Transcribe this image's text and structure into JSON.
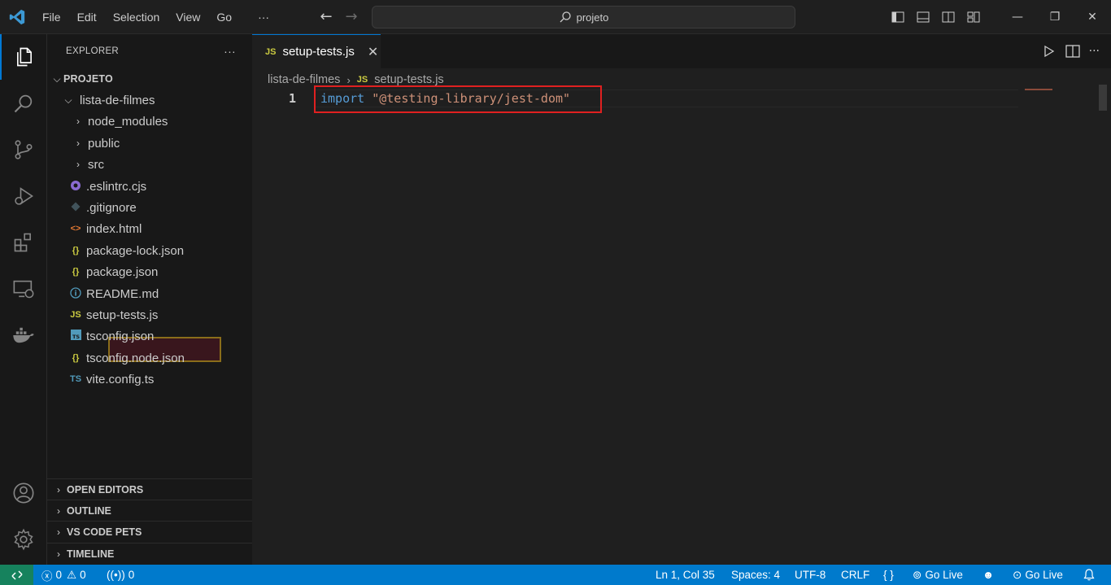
{
  "menu": [
    "File",
    "Edit",
    "Selection",
    "View",
    "Go",
    "···"
  ],
  "search": {
    "text": "projeto"
  },
  "window_controls": {
    "minimize": "—",
    "restore": "❐",
    "close": "✕"
  },
  "sidebar": {
    "title": "EXPLORER",
    "more": "···",
    "root": "PROJETO",
    "folder": "lista-de-filmes",
    "items": [
      {
        "label": "node_modules",
        "kind": "folder"
      },
      {
        "label": "public",
        "kind": "folder"
      },
      {
        "label": "src",
        "kind": "folder"
      },
      {
        "label": ".eslintrc.cjs",
        "kind": "eslint"
      },
      {
        "label": ".gitignore",
        "kind": "git"
      },
      {
        "label": "index.html",
        "kind": "html"
      },
      {
        "label": "package-lock.json",
        "kind": "json"
      },
      {
        "label": "package.json",
        "kind": "json"
      },
      {
        "label": "README.md",
        "kind": "info"
      },
      {
        "label": "setup-tests.js",
        "kind": "js"
      },
      {
        "label": "tsconfig.json",
        "kind": "ts-json"
      },
      {
        "label": "tsconfig.node.json",
        "kind": "json"
      },
      {
        "label": "vite.config.ts",
        "kind": "ts"
      }
    ],
    "icon_glyphs": {
      "json": "{}",
      "js": "JS",
      "ts": "TS",
      "ts-json": "TS",
      "html": "<>",
      "info": "i"
    },
    "sections": [
      "OPEN EDITORS",
      "OUTLINE",
      "VS CODE PETS",
      "TIMELINE"
    ]
  },
  "editor": {
    "tab_label": "setup-tests.js",
    "tab_icon": "JS",
    "breadcrumb": [
      "lista-de-filmes",
      "setup-tests.js"
    ],
    "line_number": "1",
    "code": {
      "keyword": "import",
      "string": "\"@testing-library/jest-dom\""
    }
  },
  "statusbar": {
    "errors": "0",
    "warnings": "0",
    "ports": "0",
    "position": "Ln 1, Col 35",
    "spaces": "Spaces: 4",
    "encoding": "UTF-8",
    "eol": "CRLF",
    "braces": "{ }",
    "go_live_1": "Go Live",
    "go_live_2": "Go Live"
  },
  "colors": {
    "accent": "#007acc",
    "remote": "#16825d",
    "keyword": "#569cd6",
    "string": "#ce9178",
    "highlight_red": "#e02020",
    "highlight_gold": "#8a6d1a"
  }
}
